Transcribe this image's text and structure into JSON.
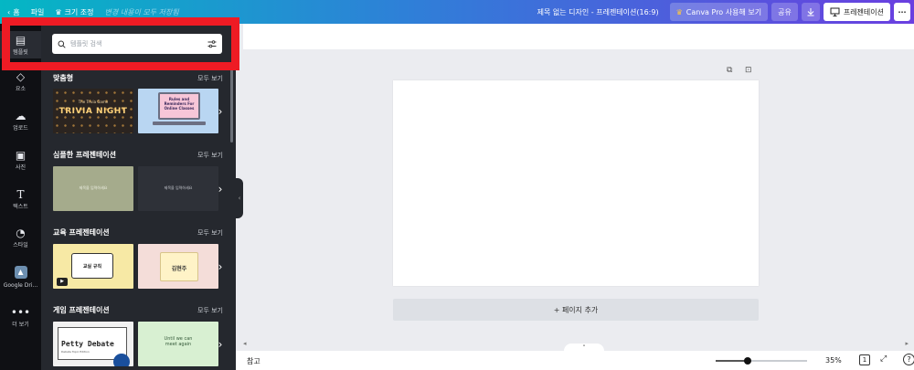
{
  "topbar": {
    "home_label": "홈",
    "file_label": "파일",
    "resize_label": "크기 조정",
    "saved_status": "변경 내용이 모두 저장됨",
    "doc_title": "제목 없는 디자인 - 프레젠테이션(16:9)",
    "pro_label": "Canva Pro 사용해 보기",
    "share_label": "공유",
    "present_label": "프레젠테이션",
    "more_label": "···"
  },
  "rail": {
    "templates": "템플릿",
    "elements": "요소",
    "uploads": "업로드",
    "photos": "사진",
    "text": "텍스트",
    "styles": "스타일",
    "google_drive": "Google Dri...",
    "more": "더 보기"
  },
  "panel": {
    "search_placeholder": "템플릿 검색",
    "see_all": "모두 보기",
    "sections": [
      {
        "title": "맞춤형"
      },
      {
        "title": "심플한 프레젠테이션"
      },
      {
        "title": "교육 프레젠테이션"
      },
      {
        "title": "게임 프레젠테이션"
      }
    ],
    "thumbs": {
      "trivia_small": "The Trivia Game",
      "trivia": "TRIVIA NIGHT",
      "rules": "Rules and Reminders For Online Classes",
      "simple_placeholder": "제목을 입력하세요",
      "class_rules": "교실 규칙",
      "name": "김현주",
      "petty": "Petty Debate",
      "petty_sub": "Debate Topic Edition",
      "until": "Until we can meet again"
    }
  },
  "canvas": {
    "add_page": "+ 페이지 추가"
  },
  "bottombar": {
    "notes": "참고",
    "zoom_percent": 35,
    "zoom": "35%",
    "page_count": "1"
  },
  "colors": {
    "accent_red": "#ee1b24",
    "topbar_start": "#04b7c4",
    "topbar_end": "#6a3fe0",
    "panel_bg": "#25282e",
    "rail_bg": "#0f1014"
  }
}
